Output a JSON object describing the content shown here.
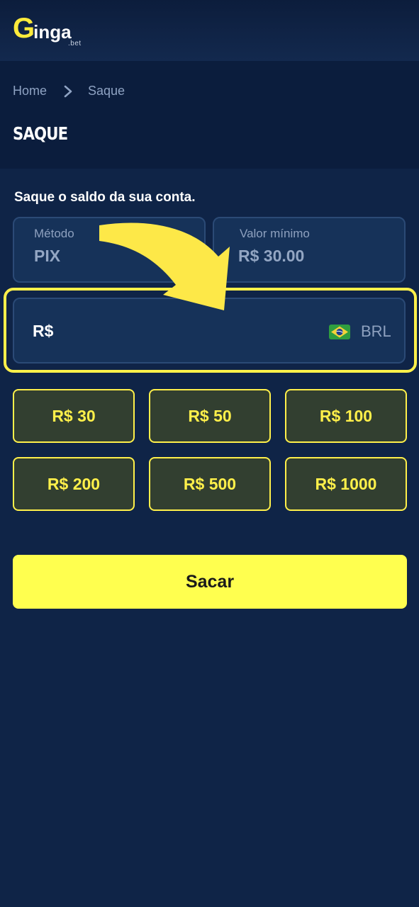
{
  "brand": {
    "logo_initial": "G",
    "logo_text": "inga",
    "logo_suffix": ".bet"
  },
  "breadcrumb": {
    "home": "Home",
    "current": "Saque"
  },
  "page": {
    "title": "SAQUE",
    "subtitle": "Saque o saldo da sua conta."
  },
  "method": {
    "label": "Método",
    "value": "PIX"
  },
  "minimum": {
    "label": "Valor mínimo",
    "value": "R$ 30.00"
  },
  "amount": {
    "prefix": "R$",
    "currency": "BRL",
    "flag_icon": "brazil-flag-icon",
    "value": ""
  },
  "presets": [
    "R$ 30",
    "R$ 50",
    "R$ 100",
    "R$ 200",
    "R$ 500",
    "R$ 1000"
  ],
  "submit_label": "Sacar",
  "colors": {
    "background": "#0f2447",
    "accent_yellow": "#fff04a",
    "button_yellow": "#ffff4f",
    "card_bg": "#163259",
    "preset_bg": "#323f30"
  }
}
